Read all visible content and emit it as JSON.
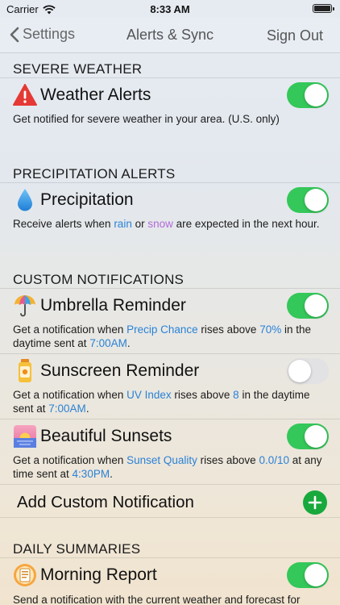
{
  "status": {
    "carrier": "Carrier",
    "time": "8:33 AM"
  },
  "nav": {
    "back_label": "Settings",
    "title": "Alerts & Sync",
    "right_label": "Sign Out"
  },
  "colors": {
    "toggle_on": "#34c759",
    "toggle_off": "#e2e2e4",
    "link_blue": "#2a82d6",
    "link_purple": "#b36ad8",
    "add_green": "#18a93c"
  },
  "sections": {
    "severe": "SEVERE WEATHER",
    "precip": "PRECIPITATION ALERTS",
    "custom": "CUSTOM NOTIFICATIONS",
    "daily": "DAILY SUMMARIES"
  },
  "weather_alerts": {
    "icon": "warning-icon",
    "title": "Weather Alerts",
    "desc": "Get notified for severe weather in your area. (U.S. only)",
    "enabled": true
  },
  "precipitation": {
    "icon": "raindrop-icon",
    "title": "Precipitation",
    "desc_a": "Receive alerts when ",
    "desc_rain": "rain",
    "desc_b": " or ",
    "desc_snow": "snow",
    "desc_c": " are expected in the next hour.",
    "enabled": true
  },
  "umbrella": {
    "icon": "umbrella-icon",
    "title": "Umbrella Reminder",
    "desc_a": "Get a notification when ",
    "metric": "Precip Chance",
    "desc_b": " rises above ",
    "threshold": "70%",
    "desc_c": " in the daytime sent at ",
    "time": "7:00AM",
    "desc_d": ".",
    "enabled": true
  },
  "sunscreen": {
    "icon": "sunscreen-icon",
    "title": "Sunscreen Reminder",
    "desc_a": "Get a notification when ",
    "metric": "UV Index",
    "desc_b": " rises above ",
    "threshold": "8",
    "desc_c": " in the daytime sent at ",
    "time": "7:00AM",
    "desc_d": ".",
    "enabled": false
  },
  "sunsets": {
    "icon": "sunset-icon",
    "title": "Beautiful Sunsets",
    "desc_a": "Get a notification when ",
    "metric": "Sunset Quality",
    "desc_b": " rises above ",
    "threshold": "0.0/10",
    "desc_c": " at any time sent at ",
    "time": "4:30PM",
    "desc_d": ".",
    "enabled": true
  },
  "add_custom": {
    "label": "Add Custom Notification",
    "icon": "plus-icon"
  },
  "morning_report": {
    "icon": "report-icon",
    "title": "Morning Report",
    "desc": "Send a notification with the current weather and forecast for",
    "enabled": true
  }
}
